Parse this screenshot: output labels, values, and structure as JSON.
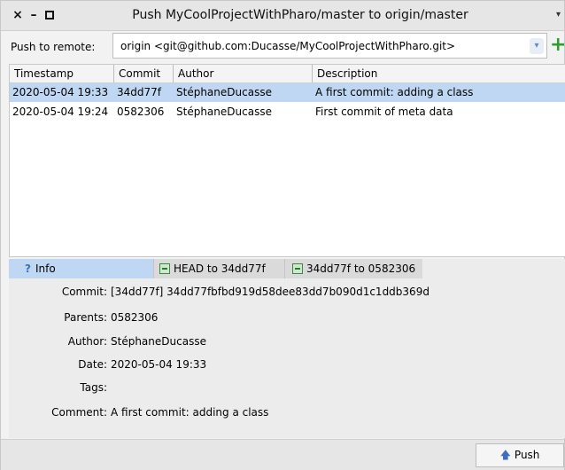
{
  "window": {
    "title": "Push MyCoolProjectWithPharo/master to origin/master",
    "close_glyph": "×",
    "minimize_glyph": "–",
    "menu_glyph": "▾"
  },
  "remote": {
    "label": "Push to remote:",
    "selected": "origin <git@github.com:Ducasse/MyCoolProjectWithPharo.git>",
    "dropdown_glyph": "▾",
    "add_glyph": "+"
  },
  "table": {
    "columns": [
      "Timestamp",
      "Commit",
      "Author",
      "Description"
    ],
    "rows": [
      {
        "timestamp": "2020-05-04 19:33",
        "commit": "34dd77f",
        "author": "StéphaneDucasse",
        "description": "A first commit: adding a class",
        "selected": true
      },
      {
        "timestamp": "2020-05-04 19:24",
        "commit": "0582306",
        "author": "StéphaneDucasse",
        "description": "First commit of meta data",
        "selected": false
      }
    ]
  },
  "tabs": [
    {
      "label": "Info",
      "glyph": "?",
      "active": true
    },
    {
      "label": "HEAD to 34dd77f",
      "active": false
    },
    {
      "label": "34dd77f to 0582306",
      "active": false
    }
  ],
  "info": {
    "commit_label": "Commit:",
    "commit_value": "[34dd77f] 34dd77fbfbd919d58dee83dd7b090d1c1ddb369d",
    "parents_label": "Parents:",
    "parents_value": "0582306",
    "author_label": "Author:",
    "author_value": "StéphaneDucasse",
    "date_label": "Date:",
    "date_value": "2020-05-04 19:33",
    "tags_label": "Tags:",
    "tags_value": "",
    "comment_label": "Comment:",
    "comment_value": "A first commit: adding a class"
  },
  "actions": {
    "push_label": "Push",
    "push_glyph": "🡅"
  },
  "colors": {
    "selection": "#bfd7f2",
    "add_green": "#2e9e2e",
    "accent_blue": "#3d6fbf"
  }
}
